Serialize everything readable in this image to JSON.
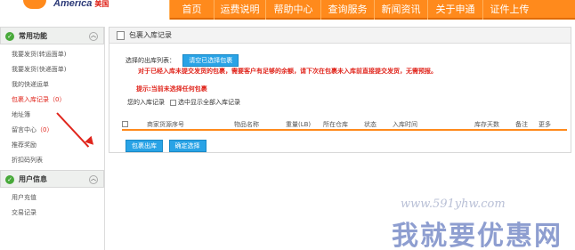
{
  "header": {
    "logo_text": "America",
    "logo_cn": "美国",
    "nav": [
      "首页",
      "运费说明",
      "帮助中心",
      "查询服务",
      "新闻资讯",
      "关于申通",
      "证件上传"
    ]
  },
  "sidebar": {
    "section1_title": "常用功能",
    "section1_items": [
      {
        "label": "我要发货(转运面单)"
      },
      {
        "label": "我要发货(快递面单)"
      },
      {
        "label": "我的快递运单"
      },
      {
        "label": "包裹入库记录",
        "count": "（0）"
      },
      {
        "label": "地址簿"
      },
      {
        "label": "留言中心",
        "count": "（0）"
      },
      {
        "label": "推荐奖励"
      },
      {
        "label": "折扣码列表"
      }
    ],
    "section2_title": "用户信息",
    "section2_items": [
      {
        "label": "用户充值"
      },
      {
        "label": "交易记录"
      }
    ]
  },
  "main": {
    "title": "包裹入库记录",
    "selected_label": "选择的出库列表：",
    "clear_button": "请空已选择包裹",
    "warning": "对于已经入库未提交发货的包裹，需要客户有足够的余额，请下次在包裹未入库前直接提交发货，无需预报。",
    "hint": "提示:当前未选择任何包裹",
    "my_records_label": "您的入库记录",
    "show_all_label": "选中显示全部入库记录",
    "columns": [
      "商家货源序号",
      "物品名称",
      "重量(LB)",
      "所在仓库",
      "状态",
      "入库时间",
      "库存天数",
      "备注",
      "更多"
    ],
    "outbound_button": "包裹出库",
    "confirm_button": "确定选择"
  },
  "watermark": {
    "url": "www.591yhw.com",
    "cn": "我就要优惠网"
  }
}
